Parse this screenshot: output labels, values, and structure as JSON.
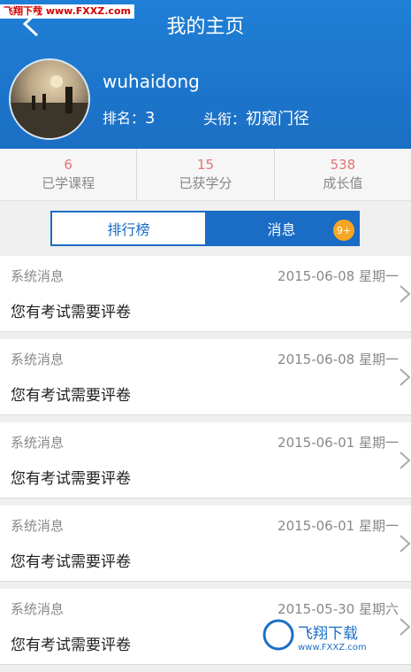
{
  "watermark_top": "飞翔下载 www.FXXZ.com",
  "header": {
    "title": "我的主页",
    "username": "wuhaidong",
    "rank_label": "排名：",
    "rank_value": "3",
    "honor_label": "头衔：",
    "honor_value": "初窥门径"
  },
  "stats": [
    {
      "value": "6",
      "label": "已学课程"
    },
    {
      "value": "15",
      "label": "已获学分"
    },
    {
      "value": "538",
      "label": "成长值"
    }
  ],
  "tabs": {
    "ranking": "排行榜",
    "messages": "消息",
    "badge": "9+"
  },
  "messages": [
    {
      "category": "系统消息",
      "date": "2015-06-08  星期一",
      "text": "您有考试需要评卷"
    },
    {
      "category": "系统消息",
      "date": "2015-06-08  星期一",
      "text": "您有考试需要评卷"
    },
    {
      "category": "系统消息",
      "date": "2015-06-01  星期一",
      "text": "您有考试需要评卷"
    },
    {
      "category": "系统消息",
      "date": "2015-06-01  星期一",
      "text": "您有考试需要评卷"
    },
    {
      "category": "系统消息",
      "date": "2015-05-30  星期六",
      "text": "您有考试需要评卷"
    }
  ],
  "watermark_bottom": {
    "brand": "飞翔下载",
    "url": "www.FXXZ.com"
  },
  "colors": {
    "header_blue": "#1b6fc4",
    "tab_blue": "#1a6cc4",
    "stat_value": "#e57373",
    "badge": "#f5a623"
  }
}
